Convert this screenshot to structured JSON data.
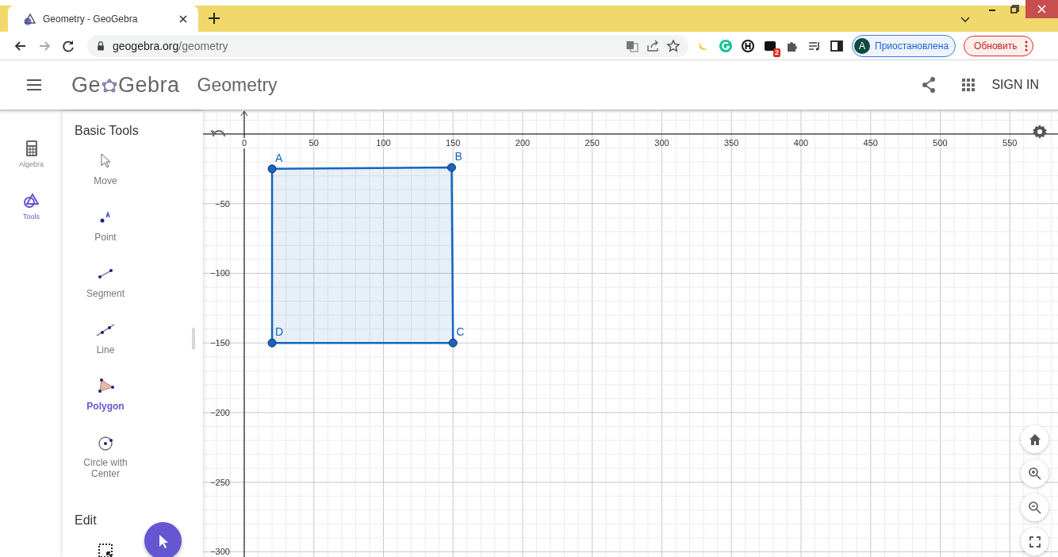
{
  "browser": {
    "tab": {
      "title": "Geometry - GeoGebra"
    },
    "address": {
      "domain": "geogebra.org",
      "path": "/geometry"
    },
    "extension_badge": "2",
    "profile": {
      "initial": "A",
      "status": "Приостановлена"
    },
    "update_button": "Обновить"
  },
  "header": {
    "logo": {
      "before": "Ge",
      "after": "Gebra"
    },
    "title": "Geometry",
    "sign_in": "SIGN IN"
  },
  "rail": [
    {
      "label": "Algebra",
      "kind": "algebra",
      "selected": false
    },
    {
      "label": "Tools",
      "kind": "tools",
      "selected": true
    }
  ],
  "tool_sections": [
    {
      "title": "Basic Tools",
      "tools": [
        {
          "label": "Move",
          "kind": "move",
          "selected": false
        },
        {
          "label": "Point",
          "kind": "point",
          "selected": false
        },
        {
          "label": "Segment",
          "kind": "segment",
          "selected": false
        },
        {
          "label": "Line",
          "kind": "line",
          "selected": false
        },
        {
          "label": "Polygon",
          "kind": "polygon",
          "selected": true
        },
        {
          "label": "Circle with Center",
          "kind": "circle",
          "selected": false
        }
      ]
    },
    {
      "title": "Edit",
      "tools": [
        {
          "kind": "select",
          "selected": false
        }
      ]
    }
  ],
  "graphics": {
    "chart_data": {
      "type": "area",
      "x": [
        20,
        149,
        150,
        20,
        20
      ],
      "xlim": [
        -29.6,
        584.6
      ],
      "grid": true,
      "ylim": [
        -303.7,
        16.5
      ],
      "series": [
        {
          "color": "#1565c0",
          "values": [
            -25,
            -24,
            -150,
            -150,
            -25
          ]
        }
      ],
      "xticks": [
        0,
        50,
        100,
        150,
        200,
        250,
        300,
        350,
        400,
        450,
        500,
        550
      ],
      "yticks": [
        {
          "value": -50,
          "label": "−50"
        },
        {
          "value": -100,
          "label": "−100"
        },
        {
          "value": -150,
          "label": "−150"
        },
        {
          "value": -200,
          "label": "−200"
        },
        {
          "value": -250,
          "label": "−250"
        },
        {
          "value": -300,
          "label": "−300"
        }
      ],
      "annotations": [
        {
          "text": "A",
          "x": 20,
          "y": -25
        },
        {
          "text": "B",
          "x": 149,
          "y": -24
        },
        {
          "text": "D",
          "x": 20,
          "y": -150
        },
        {
          "text": "C",
          "x": 150,
          "y": -150
        }
      ]
    }
  }
}
